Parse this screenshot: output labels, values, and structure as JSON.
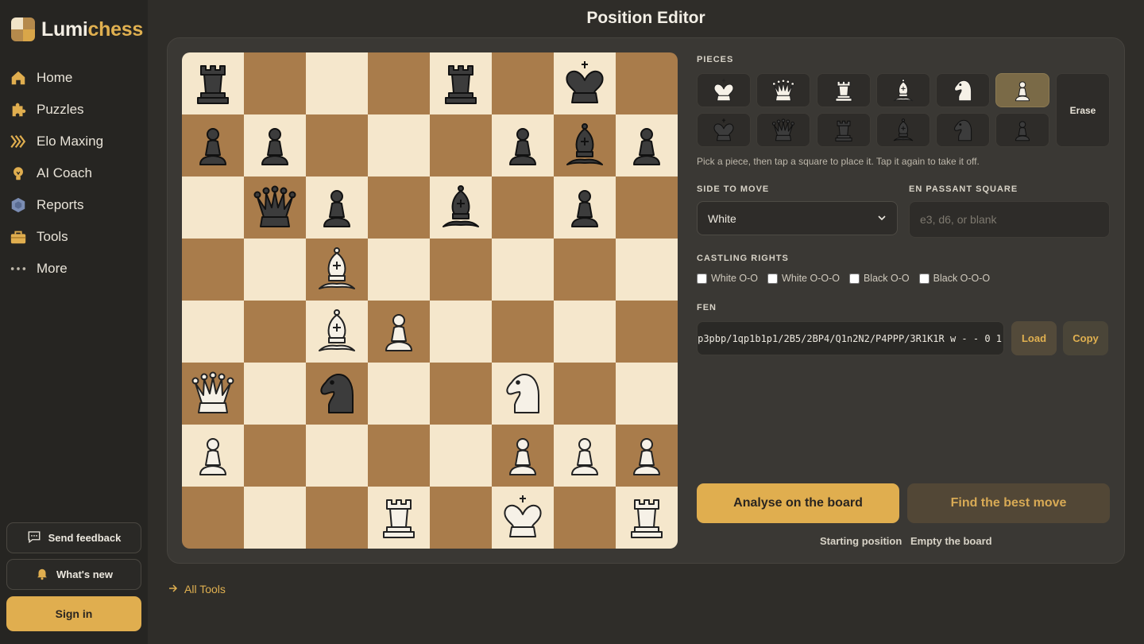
{
  "app": {
    "logo_prefix": "Lumi",
    "logo_suffix": "chess",
    "page_title": "Position Editor"
  },
  "sidebar": {
    "items": [
      {
        "label": "Home",
        "icon": "home-icon"
      },
      {
        "label": "Puzzles",
        "icon": "puzzle-icon"
      },
      {
        "label": "Elo Maxing",
        "icon": "chevrons-icon"
      },
      {
        "label": "AI Coach",
        "icon": "bulb-icon"
      },
      {
        "label": "Reports",
        "icon": "hexagon-icon"
      },
      {
        "label": "Tools",
        "icon": "toolbox-icon"
      },
      {
        "label": "More",
        "icon": "more-icon"
      }
    ],
    "feedback_label": "Send feedback",
    "whats_new_label": "What's new",
    "signin_label": "Sign in"
  },
  "board": {
    "ranks": [
      [
        "bR",
        "",
        "",
        "",
        "bR",
        "",
        "bK",
        ""
      ],
      [
        "bP",
        "bP",
        "",
        "",
        "",
        "bP",
        "bB",
        "bP"
      ],
      [
        "",
        "bQ",
        "bP",
        "",
        "bB",
        "",
        "bP",
        ""
      ],
      [
        "",
        "",
        "wB",
        "",
        "",
        "",
        "",
        ""
      ],
      [
        "",
        "",
        "wB",
        "wP",
        "",
        "",
        "",
        ""
      ],
      [
        "wQ",
        "",
        "bN",
        "",
        "",
        "wN",
        "",
        ""
      ],
      [
        "wP",
        "",
        "",
        "",
        "",
        "wP",
        "wP",
        "wP"
      ],
      [
        "",
        "",
        "",
        "wR",
        "",
        "wK",
        "",
        "wR"
      ]
    ]
  },
  "editor": {
    "pieces_label": "PIECES",
    "palette_white": [
      "wK",
      "wQ",
      "wR",
      "wB",
      "wN",
      "wP"
    ],
    "palette_black": [
      "bK",
      "bQ",
      "bR",
      "bB",
      "bN",
      "bP"
    ],
    "selected_piece": "wP",
    "erase_label": "Erase",
    "hint": "Pick a piece, then tap a square to place it. Tap it again to take it off.",
    "side_to_move_label": "SIDE TO MOVE",
    "side_to_move_value": "White",
    "en_passant_label": "EN PASSANT SQUARE",
    "en_passant_placeholder": "e3, d6, or blank",
    "castling_label": "CASTLING RIGHTS",
    "castling": [
      {
        "label": "White O-O",
        "checked": false
      },
      {
        "label": "White O-O-O",
        "checked": false
      },
      {
        "label": "Black O-O",
        "checked": false
      },
      {
        "label": "Black O-O-O",
        "checked": false
      }
    ],
    "fen_label": "FEN",
    "fen_visible_text": "p3pbp/1qp1b1p1/2B5/2BP4/Q1n2N2/P4PPP/3R1K1R w - - 0 1",
    "load_label": "Load",
    "copy_label": "Copy",
    "analyse_label": "Analyse on the board",
    "best_move_label": "Find the best move",
    "starting_position_label": "Starting position",
    "empty_board_label": "Empty the board",
    "all_tools_label": "All Tools"
  },
  "colors": {
    "accent": "#e0ae4f",
    "light_square": "#f5e7cc",
    "dark_square": "#a97c4b"
  }
}
